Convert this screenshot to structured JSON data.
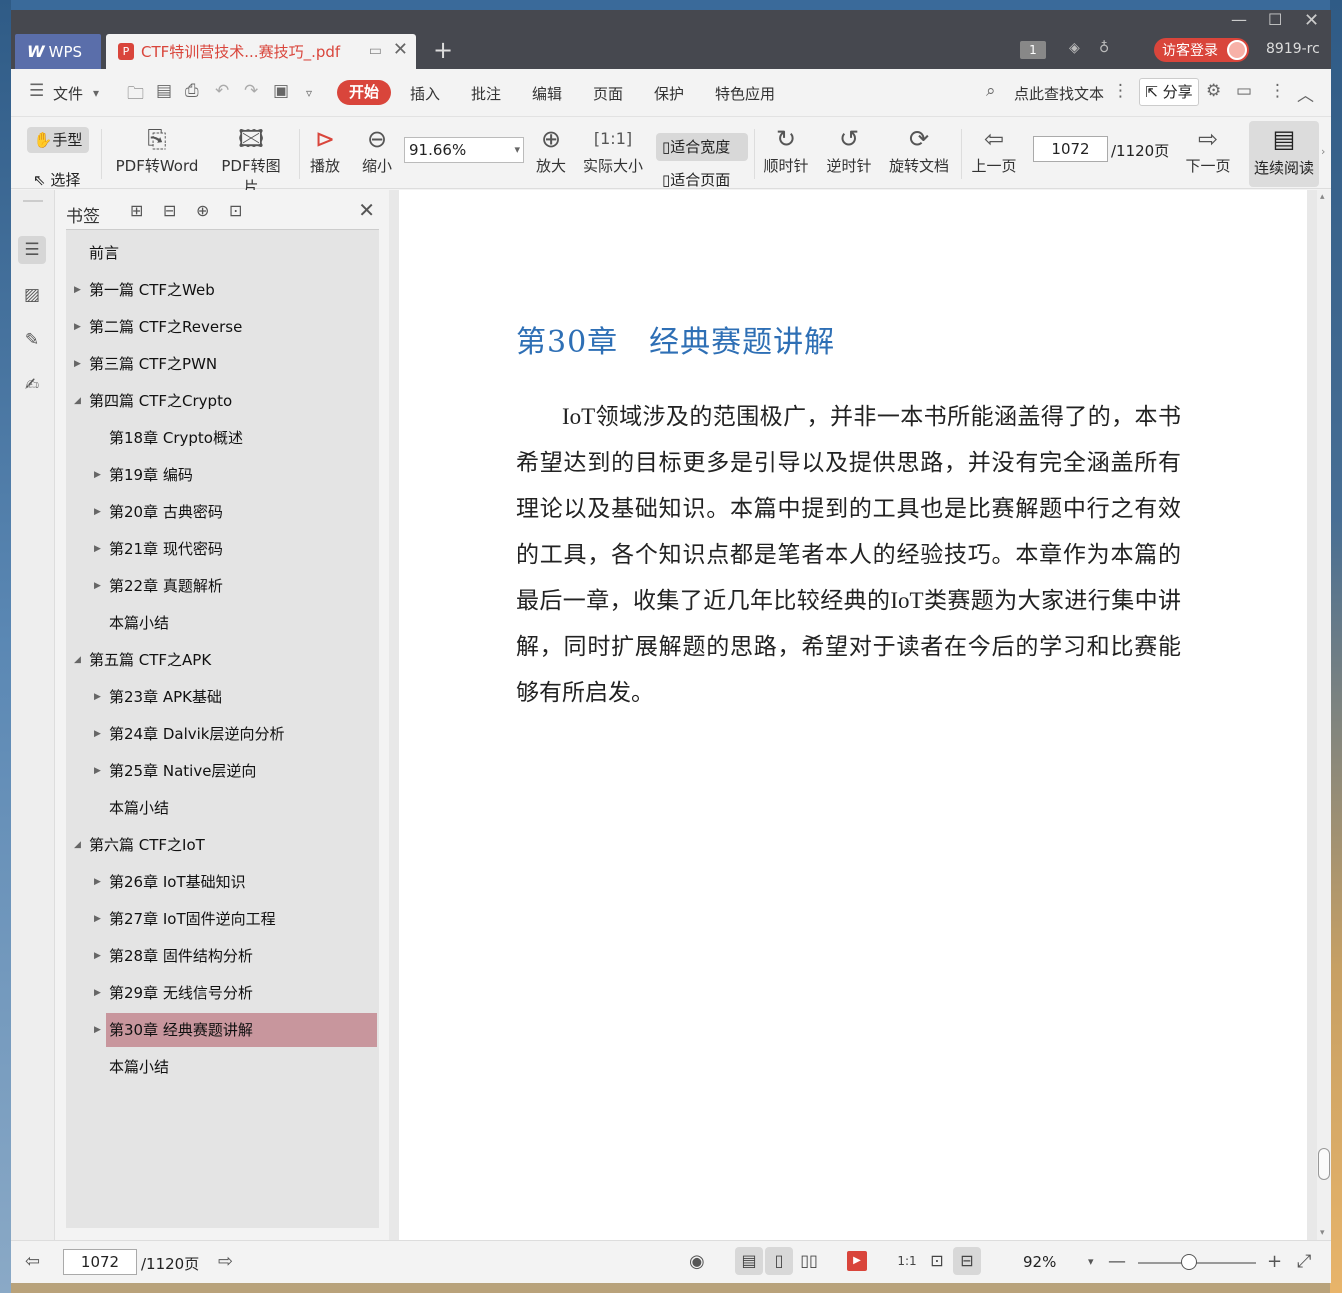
{
  "titlebar": {
    "wps_label": "WPS",
    "doc_tab_title": "CTF特训营技术...赛技巧_.pdf",
    "new_tab": "+",
    "page_badge": "1",
    "visitor_login": "访客登录",
    "version": "8919-rc"
  },
  "menu": {
    "file": "文件",
    "tabs": [
      "开始",
      "插入",
      "批注",
      "编辑",
      "页面",
      "保护",
      "特色应用"
    ],
    "search_text": "点此查找文本",
    "share": "分享"
  },
  "toolbar": {
    "hand": "手型",
    "select": "选择",
    "pdf_to_word": "PDF转Word",
    "pdf_to_image": "PDF转图片",
    "play": "播放",
    "zoom_out": "缩小",
    "zoom_value": "91.66%",
    "zoom_in": "放大",
    "actual_size": "实际大小",
    "fit_width": "适合宽度",
    "fit_page": "适合页面",
    "clockwise": "顺时针",
    "counterclockwise": "逆时针",
    "rotate_doc": "旋转文档",
    "prev_page": "上一页",
    "page_current": "1072",
    "page_total": "/1120页",
    "next_page": "下一页",
    "continuous_read": "连续阅读"
  },
  "bookmarks": {
    "title": "书签",
    "items": [
      {
        "label": "前言",
        "level": 0,
        "arrow": ""
      },
      {
        "label": "第一篇 CTF之Web",
        "level": 0,
        "arrow": "▶"
      },
      {
        "label": "第二篇 CTF之Reverse",
        "level": 0,
        "arrow": "▶"
      },
      {
        "label": "第三篇 CTF之PWN",
        "level": 0,
        "arrow": "▶"
      },
      {
        "label": "第四篇 CTF之Crypto",
        "level": 0,
        "arrow": "◢"
      },
      {
        "label": "第18章 Crypto概述",
        "level": 1,
        "arrow": ""
      },
      {
        "label": "第19章 编码",
        "level": 1,
        "arrow": "▶"
      },
      {
        "label": "第20章 古典密码",
        "level": 1,
        "arrow": "▶"
      },
      {
        "label": "第21章 现代密码",
        "level": 1,
        "arrow": "▶"
      },
      {
        "label": "第22章 真题解析",
        "level": 1,
        "arrow": "▶"
      },
      {
        "label": "本篇小结",
        "level": 1,
        "arrow": ""
      },
      {
        "label": "第五篇 CTF之APK",
        "level": 0,
        "arrow": "◢"
      },
      {
        "label": "第23章 APK基础",
        "level": 1,
        "arrow": "▶"
      },
      {
        "label": "第24章 Dalvik层逆向分析",
        "level": 1,
        "arrow": "▶"
      },
      {
        "label": "第25章 Native层逆向",
        "level": 1,
        "arrow": "▶"
      },
      {
        "label": "本篇小结",
        "level": 1,
        "arrow": ""
      },
      {
        "label": "第六篇 CTF之IoT",
        "level": 0,
        "arrow": "◢"
      },
      {
        "label": "第26章 IoT基础知识",
        "level": 1,
        "arrow": "▶"
      },
      {
        "label": "第27章 IoT固件逆向工程",
        "level": 1,
        "arrow": "▶"
      },
      {
        "label": "第28章 固件结构分析",
        "level": 1,
        "arrow": "▶"
      },
      {
        "label": "第29章 无线信号分析",
        "level": 1,
        "arrow": "▶"
      },
      {
        "label": "第30章 经典赛题讲解",
        "level": 1,
        "arrow": "▶",
        "selected": true
      },
      {
        "label": "本篇小结",
        "level": 1,
        "arrow": ""
      }
    ]
  },
  "document": {
    "chapter_title": "第30章　经典赛题讲解",
    "body": "IoT领域涉及的范围极广，并非一本书所能涵盖得了的，本书希望达到的目标更多是引导以及提供思路，并没有完全涵盖所有理论以及基础知识。本篇中提到的工具也是比赛解题中行之有效的工具，各个知识点都是笔者本人的经验技巧。本章作为本篇的最后一章，收集了近几年比较经典的IoT类赛题为大家进行集中讲解，同时扩展解题的思路，希望对于读者在今后的学习和比赛能够有所启发。"
  },
  "statusbar": {
    "page_current": "1072",
    "page_total": "/1120页",
    "zoom": "92%"
  },
  "colors": {
    "accent": "#d9453b",
    "title_blue": "#2e6fb5",
    "selected_bookmark": "#c8969d"
  }
}
